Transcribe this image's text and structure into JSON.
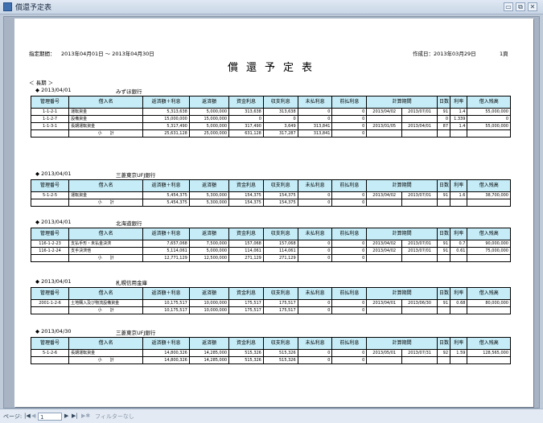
{
  "window": {
    "title": "償還予定表",
    "minimize": "▭",
    "restore": "⧉",
    "close": "✕"
  },
  "report": {
    "period_label": "指定期間：",
    "period_value": "2013年04月01日 ～ 2013年04月30日",
    "created_label": "作成日：",
    "created_value": "2013年03月29日",
    "page": "1頁",
    "title": "償還予定表",
    "group_label": "＜ 長期 ＞"
  },
  "columns": [
    "管理番号",
    "借入名",
    "返済額＋利息",
    "返済額",
    "資金利息",
    "収支利息",
    "未払利息",
    "前払利息",
    "計算期間",
    "日数",
    "利率",
    "借入残高"
  ],
  "subtotal_label": "小　　計",
  "sections": [
    {
      "date": "◆ 2013/04/01",
      "bank": "みずほ銀行",
      "rows": [
        [
          "1-1-2-1",
          "運転資金",
          "5,313,638",
          "5,000,000",
          "313,638",
          "313,638",
          "0",
          "0",
          "2013/04/02",
          "2013/07/01",
          "91",
          "1.4",
          "55,000,000"
        ],
        [
          "1-1-2-7",
          "設備資金",
          "15,000,000",
          "15,000,000",
          "0",
          "0",
          "0",
          "0",
          "",
          "",
          "0",
          "1.339",
          "0"
        ],
        [
          "1-1-3-1",
          "長期運転資金",
          "5,317,490",
          "5,000,000",
          "317,490",
          "3,649",
          "313,841",
          "0",
          "2013/01/05",
          "2013/04/01",
          "87",
          "1.4",
          "55,000,000"
        ]
      ],
      "total": [
        "25,631,128",
        "25,000,000",
        "631,128",
        "317,287",
        "313,841",
        "0"
      ]
    },
    {
      "date": "◆ 2013/04/01",
      "bank": "三菱東京UFJ銀行",
      "rows": [
        [
          "5-1-2-5",
          "運転資金",
          "5,454,375",
          "5,300,000",
          "154,375",
          "154,375",
          "0",
          "0",
          "2013/04/02",
          "2013/07/01",
          "91",
          "1.6",
          "38,700,000"
        ]
      ],
      "total": [
        "5,454,375",
        "5,300,000",
        "154,375",
        "154,375",
        "0",
        "0"
      ]
    },
    {
      "date": "◆ 2013/04/01",
      "bank": "北海道銀行",
      "rows": [
        [
          "116-1-2-23",
          "支払手形・未払金決済",
          "7,657,068",
          "7,500,000",
          "157,068",
          "157,068",
          "0",
          "0",
          "2013/04/02",
          "2013/07/01",
          "91",
          "0.7",
          "90,000,000"
        ],
        [
          "116-1-2-24",
          "支手決済他",
          "5,114,061",
          "5,000,000",
          "114,061",
          "114,061",
          "0",
          "0",
          "2013/04/02",
          "2013/07/01",
          "91",
          "0.61",
          "75,000,000"
        ]
      ],
      "total": [
        "12,771,129",
        "12,500,000",
        "271,129",
        "271,129",
        "0",
        "0"
      ]
    },
    {
      "date": "◆ 2013/04/01",
      "bank": "札幌信用金庫",
      "rows": [
        [
          "2001-1-2-6",
          "土地購入及び物流設備資金",
          "10,175,517",
          "10,000,000",
          "175,517",
          "175,517",
          "0",
          "0",
          "2013/04/01",
          "2013/06/30",
          "91",
          "0.68",
          "80,000,000"
        ]
      ],
      "total": [
        "10,175,517",
        "10,000,000",
        "175,517",
        "175,517",
        "0",
        "0"
      ]
    },
    {
      "date": "◆ 2013/04/30",
      "bank": "三菱東京UFJ銀行",
      "rows": [
        [
          "5-1-2-6",
          "長期運転資金",
          "14,800,326",
          "14,285,000",
          "515,326",
          "515,326",
          "0",
          "0",
          "2013/05/01",
          "2013/07/31",
          "92",
          "1.59",
          "128,565,000"
        ]
      ],
      "total": [
        "14,800,326",
        "14,285,000",
        "515,326",
        "515,326",
        "0",
        "0"
      ]
    }
  ],
  "statusbar": {
    "page_label": "ページ:",
    "first": "|◀",
    "prev": "◀",
    "current_page": "1",
    "next": "▶",
    "last": "▶|",
    "extra": "▶✱",
    "filter": "フィルターなし"
  }
}
